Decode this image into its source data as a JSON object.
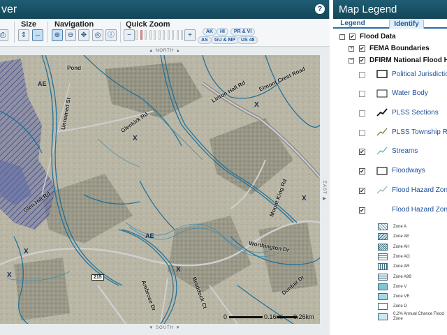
{
  "viewer": {
    "title": "ver",
    "help_label": "?",
    "toolbar": {
      "size_label": "Size",
      "navigation_label": "Navigation",
      "quick_zoom_label": "Quick Zoom",
      "zoom_level": 0.05,
      "quick_zoom_chips": [
        "AK",
        "HI",
        "PR & VI",
        "AS",
        "GU & MP",
        "US 48"
      ]
    },
    "map": {
      "north_label": "▲ NORTH ▲",
      "south_label": "▼ SOUTH ▼",
      "east_label": "EAST ▶",
      "road_labels": {
        "pond": "Pond",
        "unnamed": "Unnamed St",
        "glenkirk": "Glenkirk Rd",
        "linton_hall": "Linton Hall Rd",
        "elmont": "Elmont Crest Road",
        "glen_hill": "Glen Hill Rd",
        "mount_king": "Mount King Rd",
        "worthington": "Worthington Dr",
        "braddock": "Braddock Ct",
        "ambrose": "Ambrose Dr",
        "dunbar": "Dunbar Dr"
      },
      "zone_marks": {
        "x1": "X",
        "x2": "X",
        "x3": "X",
        "x4": "X",
        "x5": "X",
        "ae1": "AE",
        "ae2": "AE",
        "x6": "X"
      },
      "route_shield": "215",
      "scale": {
        "zero": "0",
        "mid": "0.16mi",
        "end": "0.26km"
      }
    }
  },
  "legend": {
    "title": "Map Legend",
    "tabs": {
      "legend": "Legend",
      "identify": "Identify"
    },
    "items": {
      "flood_data": "Flood Data",
      "fema_boundaries": "FEMA Boundaries",
      "dfirm": "DFIRM National Flood Haz",
      "political": "Political Jurisdictions",
      "water_body": "Water Body",
      "plss_sections": "PLSS Sections",
      "plss_township": "PLSS Township Range",
      "streams": "Streams",
      "floodways": "Floodways",
      "flood_hazard_zone_a": "Flood Hazard Zone",
      "flood_hazard_zone_b": "Flood Hazard Zones"
    },
    "zones": [
      "Zone A",
      "Zone AE",
      "Zone AH",
      "Zone AO",
      "Zone AR",
      "Zone A99",
      "Zone V",
      "Zone VE",
      "Zone D",
      "0.2% Annual Chance Flood Zone"
    ]
  }
}
